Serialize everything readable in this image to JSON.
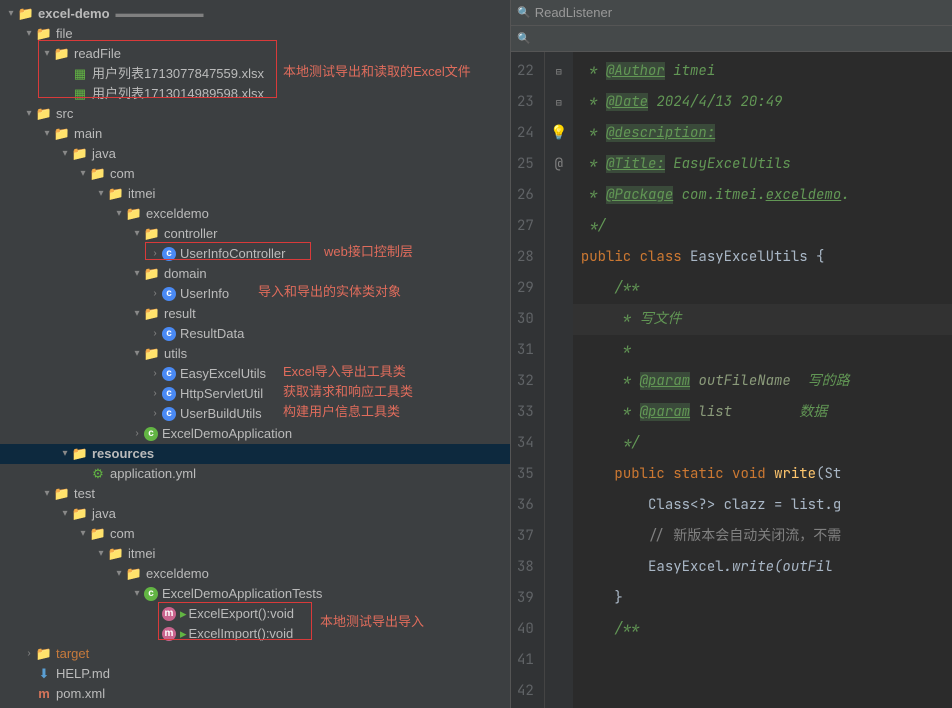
{
  "search": {
    "readListener": "ReadListener",
    "placeholder": ""
  },
  "tree": {
    "root": "excel-demo",
    "file": "file",
    "readFile": "readFile",
    "xlsx1": "用户列表1713077847559.xlsx",
    "xlsx2": "用户列表1713014989598.xlsx",
    "src": "src",
    "main": "main",
    "java": "java",
    "com": "com",
    "itmei": "itmei",
    "exceldemo": "exceldemo",
    "controller": "controller",
    "userInfoController": "UserInfoController",
    "domain": "domain",
    "userInfo": "UserInfo",
    "result": "result",
    "resultData": "ResultData",
    "utils": "utils",
    "easyExcelUtils": "EasyExcelUtils",
    "httpServletUtil": "HttpServletUtil",
    "userBuildUtils": "UserBuildUtils",
    "excelDemoApplication": "ExcelDemoApplication",
    "resources": "resources",
    "applicationYml": "application.yml",
    "test": "test",
    "excelDemoApplicationTests": "ExcelDemoApplicationTests",
    "excelExport": "ExcelExport():void",
    "excelImport": "ExcelImport():void",
    "target": "target",
    "helpMd": "HELP.md",
    "pomXml": "pom.xml"
  },
  "annotations": {
    "localTest": "本地测试导出和读取的Excel文件",
    "webLayer": "web接口控制层",
    "entityClass": "导入和导出的实体类对象",
    "excelUtil": "Excel导入导出工具类",
    "httpUtil": "获取请求和响应工具类",
    "userUtil": "构建用户信息工具类",
    "testImportExport": "本地测试导出导入"
  },
  "code": {
    "lines": [
      "22",
      "23",
      "24",
      "25",
      "26",
      "27",
      "28",
      "29",
      "30",
      "31",
      "32",
      "33",
      "34",
      "35",
      "36",
      "37",
      "38",
      "39",
      "40",
      "41",
      "42"
    ],
    "authorTag": "@Author",
    "authorVal": "itmei",
    "dateTag": "@Date",
    "dateVal": "2024/4/13 20:49",
    "descTag": "@description:",
    "titleTag": "@Title:",
    "titleVal": "EasyExcelUtils",
    "packageTag": "@Package",
    "packageVal": "com.itmei.",
    "packageLink": "exceldemo",
    "public": "public",
    "class": "class",
    "className": "EasyExcelUtils",
    "writeComment": "写文件",
    "param": "@param",
    "param1": "outFileName",
    "param1Desc": "写的路",
    "param2": "list",
    "param2Desc": "数据",
    "static": "static",
    "void": "void",
    "write": "write",
    "writeArg": "(St",
    "classLine": "Class<?> clazz = list.g",
    "commentLine": "// 新版本会自动关闭流，不需",
    "easyExcel": "EasyExcel",
    "writeCall": ".write(outFil"
  }
}
